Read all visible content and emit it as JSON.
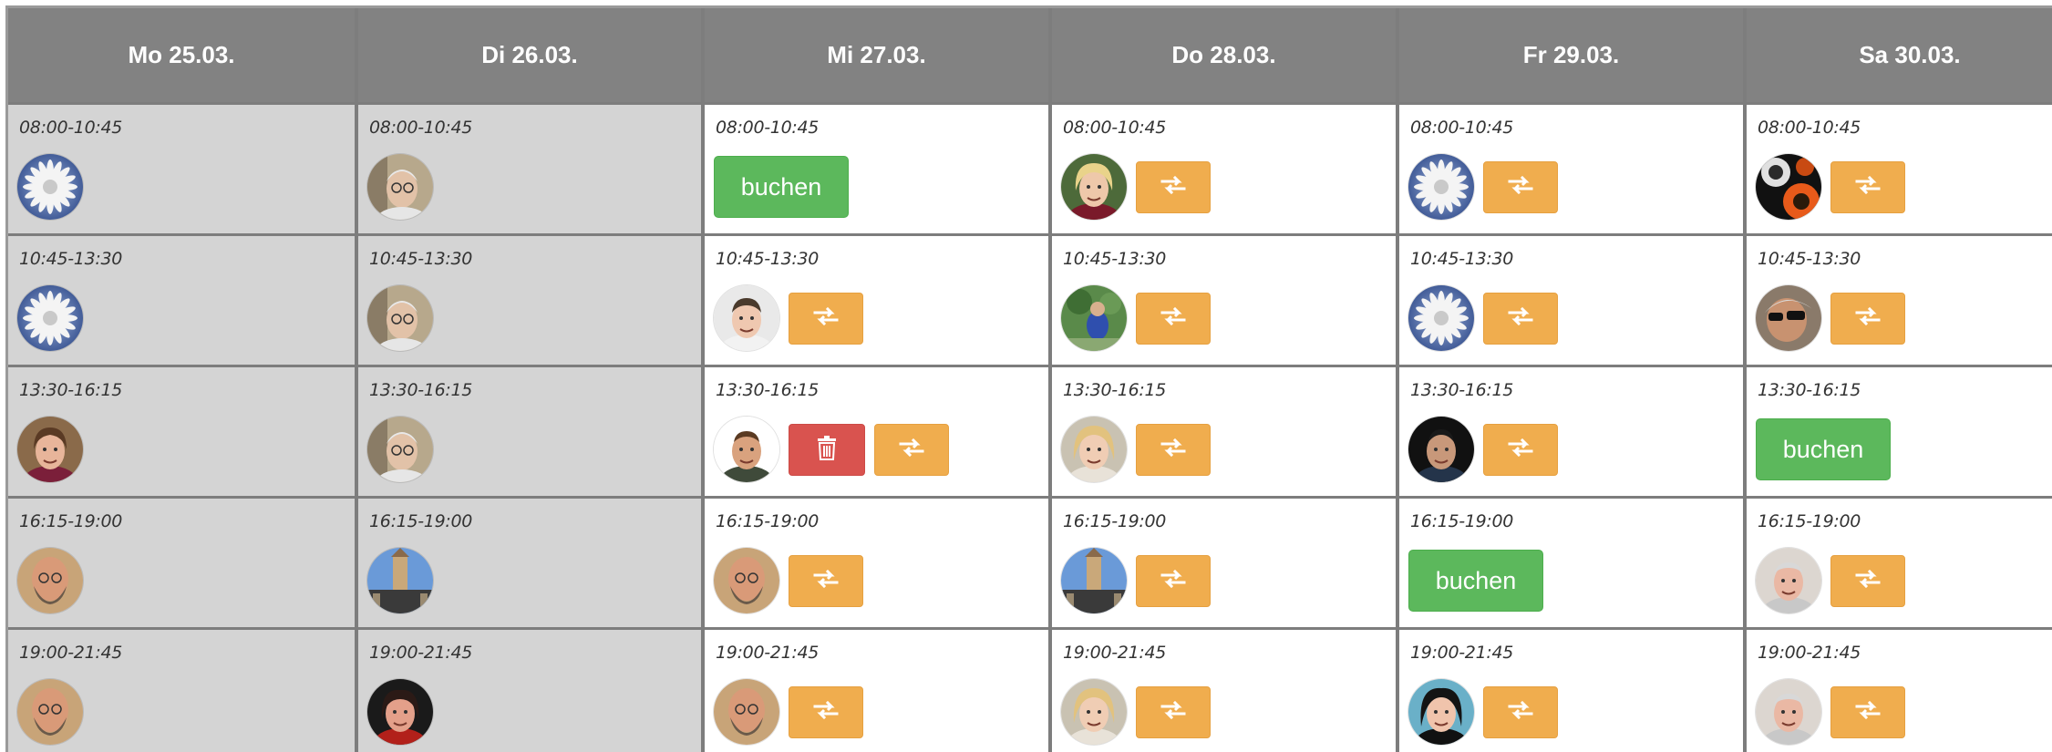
{
  "days": [
    {
      "label": "Mo 25.03.",
      "past": true,
      "slots": [
        {
          "time": "08:00-10:45",
          "avatar": "daisy",
          "actions": []
        },
        {
          "time": "10:45-13:30",
          "avatar": "daisy",
          "actions": []
        },
        {
          "time": "13:30-16:15",
          "avatar": "woman-short-hair",
          "actions": []
        },
        {
          "time": "16:15-19:00",
          "avatar": "bald-bearded-man",
          "actions": []
        },
        {
          "time": "19:00-21:45",
          "avatar": "bald-bearded-man",
          "actions": []
        }
      ]
    },
    {
      "label": "Di 26.03.",
      "past": true,
      "slots": [
        {
          "time": "08:00-10:45",
          "avatar": "older-man-glasses",
          "actions": []
        },
        {
          "time": "10:45-13:30",
          "avatar": "older-man-glasses",
          "actions": []
        },
        {
          "time": "13:30-16:15",
          "avatar": "older-man-glasses",
          "actions": []
        },
        {
          "time": "16:15-19:00",
          "avatar": "tower",
          "actions": []
        },
        {
          "time": "19:00-21:45",
          "avatar": "dark-hair-woman",
          "actions": []
        }
      ]
    },
    {
      "label": "Mi 27.03.",
      "past": false,
      "slots": [
        {
          "time": "08:00-10:45",
          "avatar": null,
          "actions": [
            "book"
          ]
        },
        {
          "time": "10:45-13:30",
          "avatar": "smiling-man",
          "actions": [
            "swap"
          ]
        },
        {
          "time": "13:30-16:15",
          "avatar": "young-man",
          "actions": [
            "delete",
            "swap"
          ]
        },
        {
          "time": "16:15-19:00",
          "avatar": "bald-bearded-man",
          "actions": [
            "swap"
          ]
        },
        {
          "time": "19:00-21:45",
          "avatar": "bald-bearded-man",
          "actions": [
            "swap"
          ]
        }
      ]
    },
    {
      "label": "Do 28.03.",
      "past": false,
      "slots": [
        {
          "time": "08:00-10:45",
          "avatar": "blonde-older-woman",
          "actions": [
            "swap"
          ]
        },
        {
          "time": "10:45-13:30",
          "avatar": "garden-scene",
          "actions": [
            "swap"
          ]
        },
        {
          "time": "13:30-16:15",
          "avatar": "blonde-woman",
          "actions": [
            "swap"
          ]
        },
        {
          "time": "16:15-19:00",
          "avatar": "tower",
          "actions": [
            "swap"
          ]
        },
        {
          "time": "19:00-21:45",
          "avatar": "blonde-woman",
          "actions": [
            "swap"
          ]
        }
      ]
    },
    {
      "label": "Fr 29.03.",
      "past": false,
      "slots": [
        {
          "time": "08:00-10:45",
          "avatar": "daisy",
          "actions": [
            "swap"
          ]
        },
        {
          "time": "10:45-13:30",
          "avatar": "daisy",
          "actions": [
            "swap"
          ]
        },
        {
          "time": "13:30-16:15",
          "avatar": "man-dark-background",
          "actions": [
            "swap"
          ]
        },
        {
          "time": "16:15-19:00",
          "avatar": null,
          "actions": [
            "book"
          ]
        },
        {
          "time": "19:00-21:45",
          "avatar": "dark-hair-woman-smiling",
          "actions": [
            "swap"
          ]
        }
      ]
    },
    {
      "label": "Sa 30.03.",
      "past": false,
      "slots": [
        {
          "time": "08:00-10:45",
          "avatar": "orange-eye",
          "actions": [
            "swap"
          ]
        },
        {
          "time": "10:45-13:30",
          "avatar": "man-sunglasses",
          "actions": [
            "swap"
          ]
        },
        {
          "time": "13:30-16:15",
          "avatar": null,
          "actions": [
            "book"
          ]
        },
        {
          "time": "16:15-19:00",
          "avatar": "older-man",
          "actions": [
            "swap"
          ]
        },
        {
          "time": "19:00-21:45",
          "avatar": "older-man",
          "actions": [
            "swap"
          ]
        }
      ]
    }
  ],
  "labels": {
    "book": "buchen"
  },
  "icons": {
    "swap": "swap-arrows-icon",
    "delete": "trash-icon"
  },
  "colors": {
    "header_bg": "#828282",
    "past_bg": "#d4d4d4",
    "book": "#5cb85c",
    "swap": "#f0ad4e",
    "delete": "#d9534f"
  }
}
